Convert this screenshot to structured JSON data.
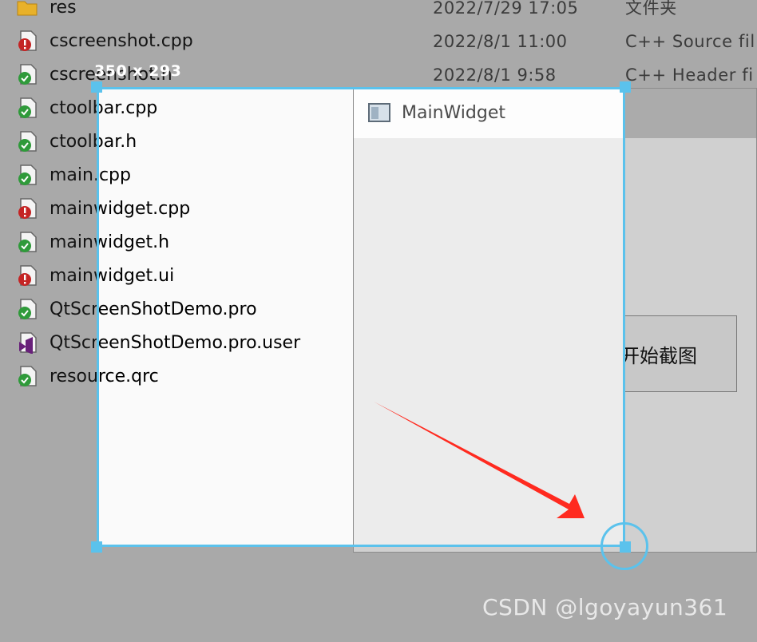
{
  "selection": {
    "size_label": "350 x 293"
  },
  "files": [
    {
      "name": "res",
      "date": "2022/7/29 17:05",
      "type": "文件夹",
      "icon": "folder-icon"
    },
    {
      "name": "cscreenshot.cpp",
      "date": "2022/8/1 11:00",
      "type": "C++ Source fil",
      "icon": "modified-file-icon"
    },
    {
      "name": "cscreenshot.h",
      "date": "2022/8/1 9:58",
      "type": "C++ Header fi",
      "icon": "synced-file-icon"
    },
    {
      "name": "ctoolbar.cpp",
      "date": "",
      "type": "",
      "icon": "synced-file-icon"
    },
    {
      "name": "ctoolbar.h",
      "date": "",
      "type": "",
      "icon": "synced-file-icon"
    },
    {
      "name": "main.cpp",
      "date": "",
      "type": "",
      "icon": "synced-file-icon"
    },
    {
      "name": "mainwidget.cpp",
      "date": "",
      "type": "",
      "icon": "modified-file-icon"
    },
    {
      "name": "mainwidget.h",
      "date": "",
      "type": "",
      "icon": "synced-file-icon"
    },
    {
      "name": "mainwidget.ui",
      "date": "",
      "type": "",
      "icon": "modified-file-icon"
    },
    {
      "name": "QtScreenShotDemo.pro",
      "date": "",
      "type": "",
      "icon": "synced-file-icon"
    },
    {
      "name": "QtScreenShotDemo.pro.user",
      "date": "",
      "type": "",
      "icon": "visual-studio-file-icon"
    },
    {
      "name": "resource.qrc",
      "date": "",
      "type": "",
      "icon": "synced-file-icon"
    }
  ],
  "main_widget": {
    "title": "MainWidget",
    "icon": "window-icon",
    "capture_button_label": "开始截图"
  },
  "watermark": "CSDN @lgoyayun361",
  "colors": {
    "selection_border": "#5bc2ec",
    "arrow": "#ff2a1f",
    "dim_overlay": "#a9a9a9"
  }
}
